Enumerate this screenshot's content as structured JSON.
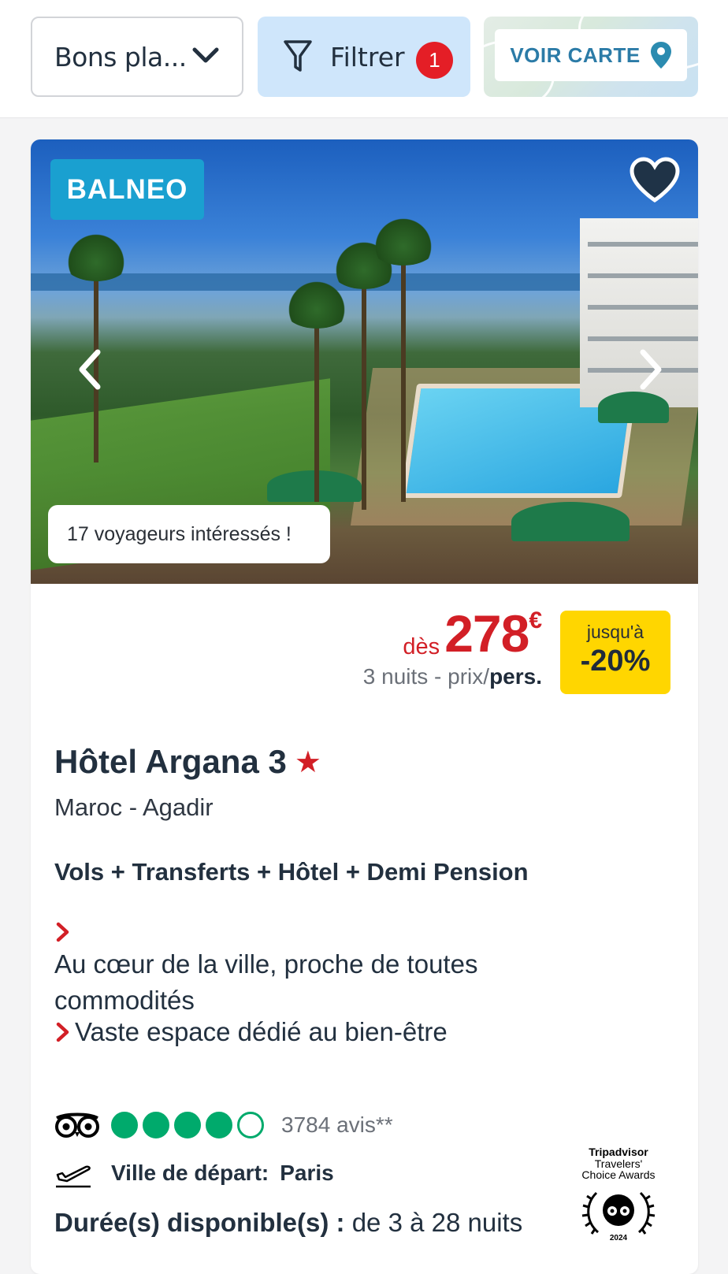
{
  "toolbar": {
    "sort_label": "Bons pla...",
    "filter_label": "Filtrer",
    "filter_count": "1",
    "map_label": "VOIR CARTE"
  },
  "offer": {
    "tag": "BALNEO",
    "interest_text": "17 voyageurs intéressés !",
    "price_prefix": "dès",
    "price_amount": "278",
    "price_currency": "€",
    "price_note": "3 nuits - prix/",
    "price_note_bold": "pers.",
    "promo_prefix": "jusqu'à",
    "promo_value": "-20%",
    "hotel_name": "Hôtel Argana 3",
    "star_glyph": "★",
    "location": "Maroc - Agadir",
    "formula": "Vols + Transferts + Hôtel + Demi Pension",
    "features": [
      "Au cœur de la ville, proche de toutes commodités",
      "Vaste espace dédié au bien-être"
    ],
    "rating_bubbles": 4,
    "rating_max": 5,
    "reviews": "3784 avis**",
    "departure_label": "Ville de départ:",
    "departure_city": "Paris",
    "duration_label": "Durée(s) disponible(s) :",
    "duration_value": "de 3 à 28 nuits",
    "award": {
      "brand": "Tripadvisor",
      "line1": "Travelers'",
      "line2": "Choice Awards",
      "year": "2024"
    }
  },
  "colors": {
    "accent_red": "#d21f26",
    "tag_blue": "#1aa0d0",
    "promo_yellow": "#ffd600",
    "tripadvisor_green": "#00aa6c",
    "filter_bg": "#cfe6fb"
  },
  "icons": [
    "chevron-down-icon",
    "filter-funnel-icon",
    "map-pin-icon",
    "heart-icon",
    "chevron-left-icon",
    "chevron-right-icon",
    "tripadvisor-owl-icon",
    "plane-takeoff-icon"
  ]
}
